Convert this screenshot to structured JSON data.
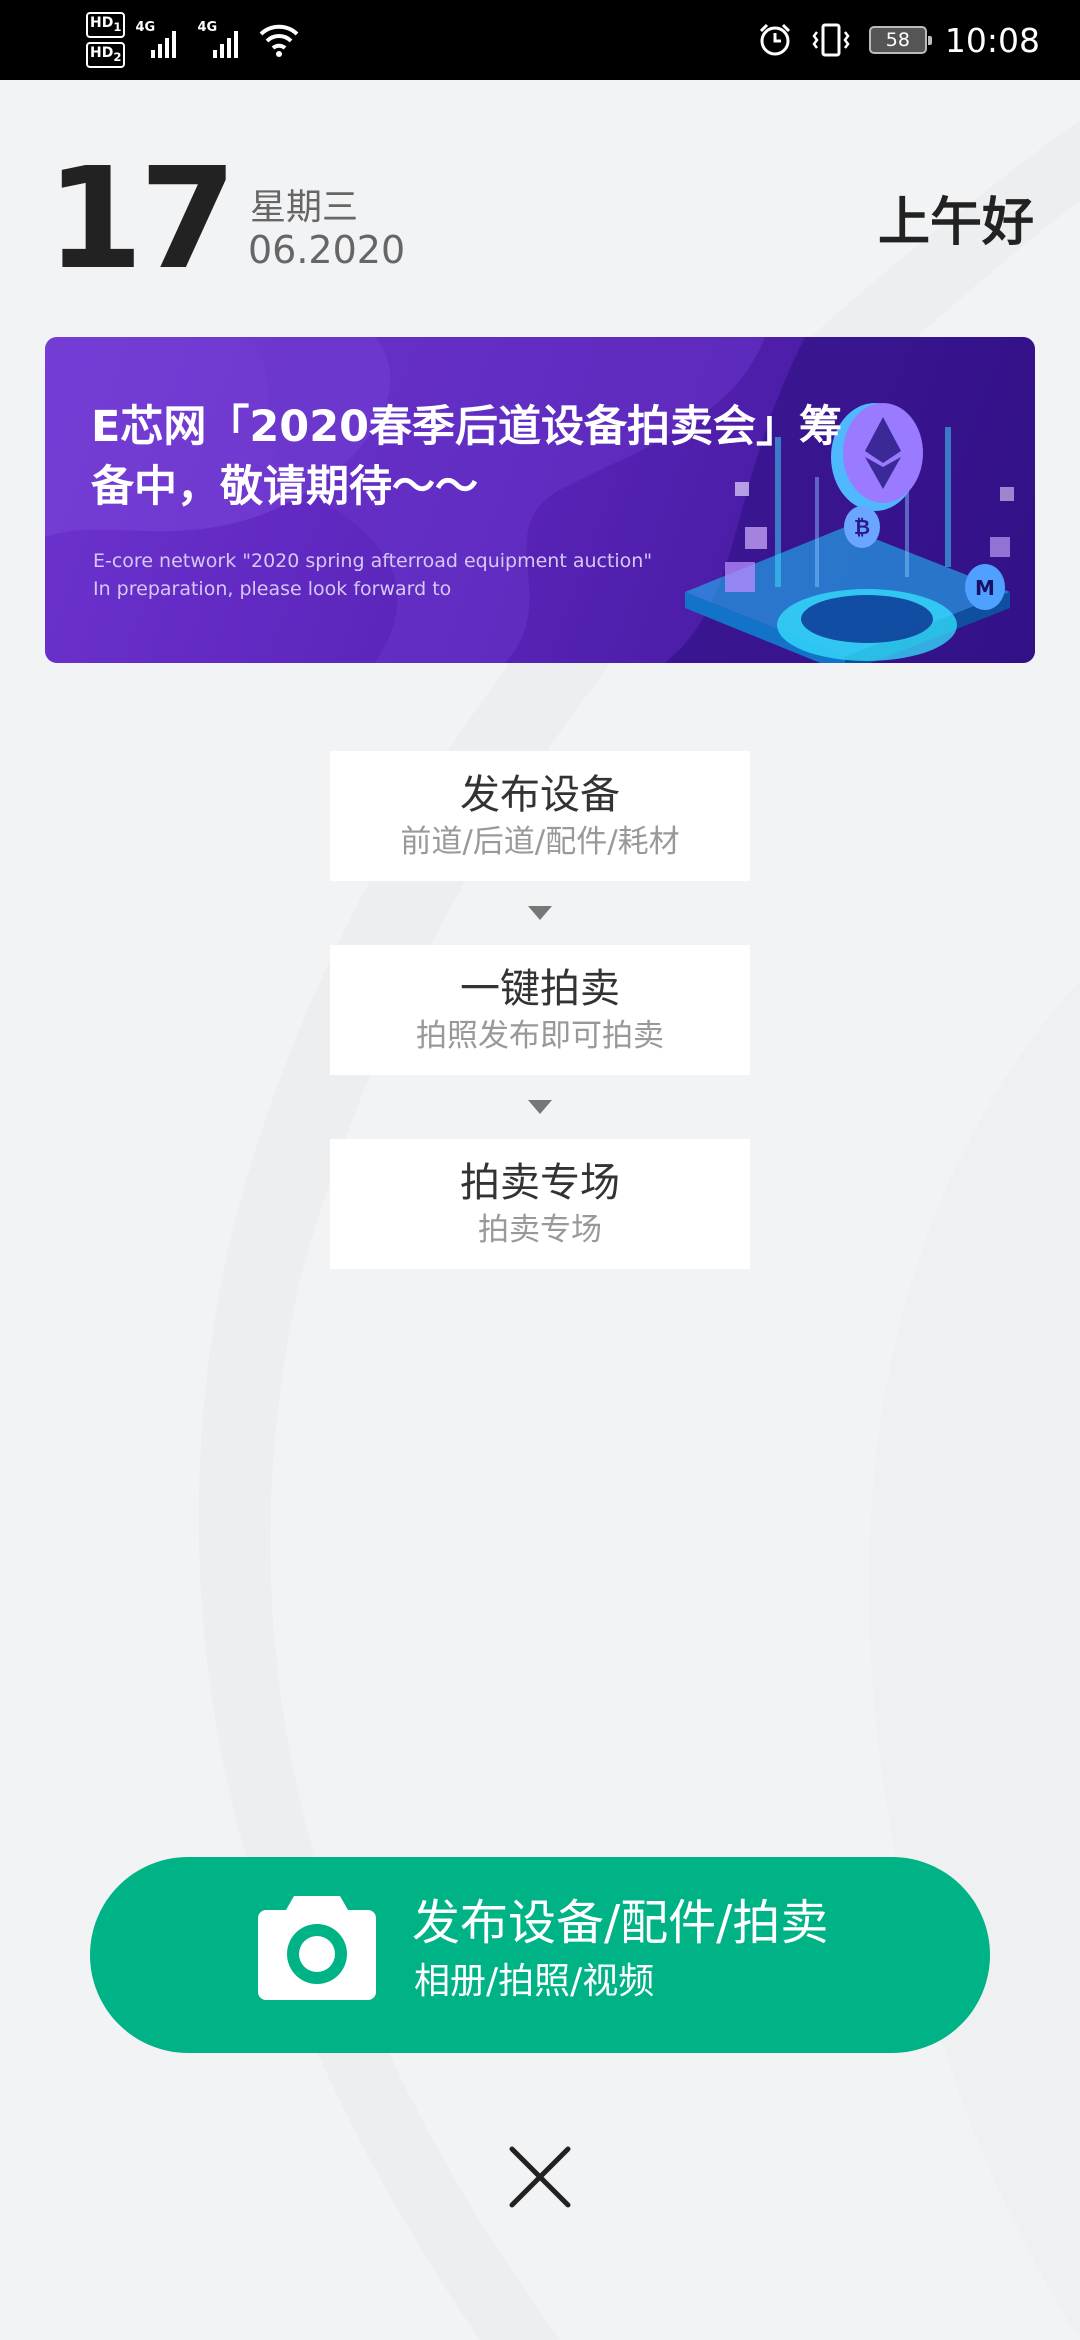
{
  "status_bar": {
    "hd1": "HD",
    "hd1_sub": "1",
    "hd2": "HD",
    "hd2_sub": "2",
    "net1": "4G",
    "net2": "4G",
    "battery": "58",
    "time": "10:08",
    "icons": [
      "wifi-icon",
      "alarm-icon",
      "vibrate-icon",
      "battery-icon"
    ]
  },
  "header": {
    "day": "17",
    "weekday": "星期三",
    "month_year": "06.2020",
    "greeting": "上午好"
  },
  "banner": {
    "title": "E芯网「2020春季后道设备拍卖会」筹备中，敬请期待～～",
    "subtitle_en_line1": "E-core network \"2020 spring afterroad equipment auction\"",
    "subtitle_en_line2": "In preparation, please look forward to"
  },
  "steps": [
    {
      "title": "发布设备",
      "subtitle": "前道/后道/配件/耗材"
    },
    {
      "title": "一键拍卖",
      "subtitle": "拍照发布即可拍卖"
    },
    {
      "title": "拍卖专场",
      "subtitle": "拍卖专场"
    }
  ],
  "publish_button": {
    "title": "发布设备/配件/拍卖",
    "subtitle": "相册/拍照/视频",
    "icon": "camera-icon"
  },
  "close_button": {
    "icon": "close-icon"
  },
  "colors": {
    "accent_green": "#00b386",
    "banner_purple": "#5a24b9",
    "background": "#f2f3f4"
  }
}
